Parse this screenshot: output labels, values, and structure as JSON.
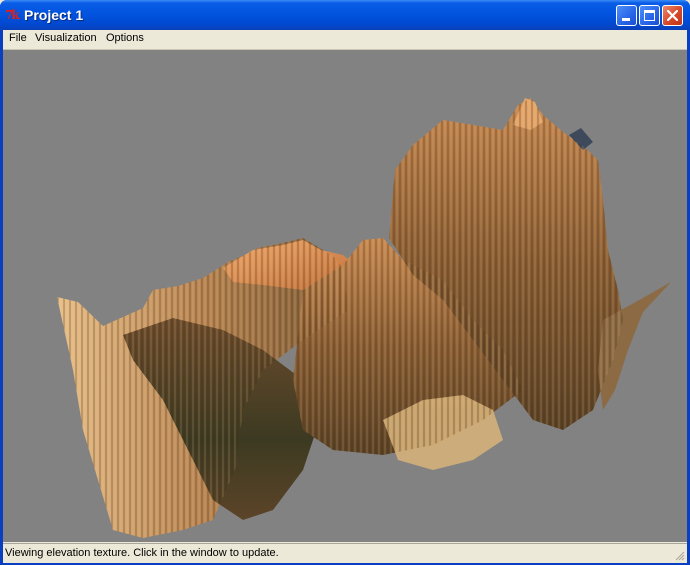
{
  "window": {
    "title": "Project 1",
    "app_icon_glyph": "7k",
    "buttons": [
      "minimize-icon",
      "maximize-icon",
      "close-icon"
    ]
  },
  "menu": {
    "items": [
      "File",
      "Visualization",
      "Options"
    ]
  },
  "viewport": {
    "background": "#828282",
    "content": "3d-terrain-render"
  },
  "status": {
    "text": "Viewing elevation texture. Click in the window to update."
  },
  "colors": {
    "titlebar": "#0254e0",
    "close_button": "#d7482a",
    "terrain_light": "#e2a56a",
    "terrain_dark": "#4a3a20"
  }
}
